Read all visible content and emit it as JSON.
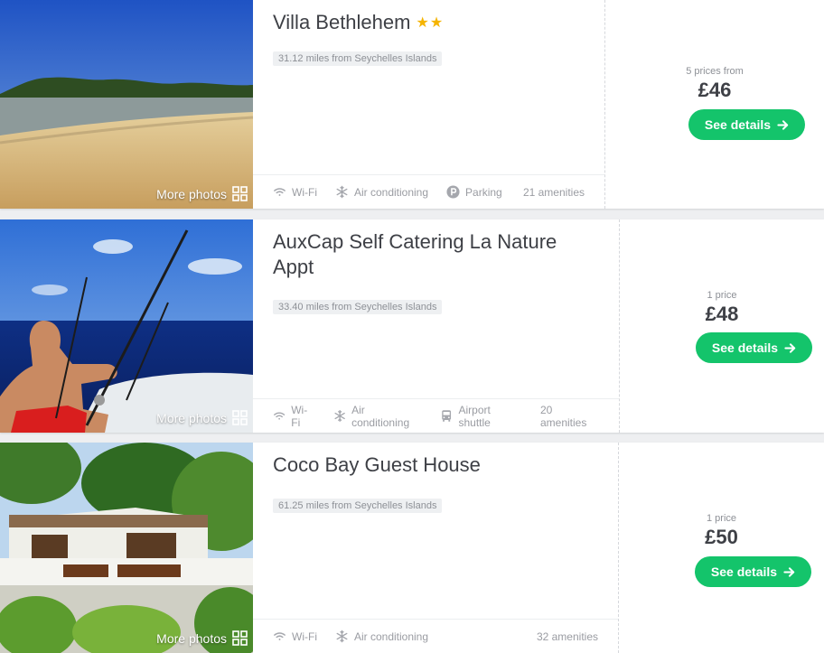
{
  "listings": [
    {
      "name": "Villa Bethlehem",
      "stars": "★★",
      "distance": "31.12 miles from Seychelles Islands",
      "more_photos": "More photos",
      "amenities": [
        {
          "icon": "wifi-icon",
          "label": "Wi-Fi"
        },
        {
          "icon": "snowflake-icon",
          "label": "Air conditioning"
        },
        {
          "icon": "parking-icon",
          "label": "Parking"
        }
      ],
      "amenity_count": "21 amenities",
      "prices_from": "5 prices from",
      "price": "£46",
      "cta": "See details"
    },
    {
      "name": "AuxCap Self Catering La Nature Appt",
      "distance": "33.40 miles from Seychelles Islands",
      "more_photos": "More photos",
      "amenities": [
        {
          "icon": "wifi-icon",
          "label": "Wi-Fi"
        },
        {
          "icon": "snowflake-icon",
          "label": "Air conditioning"
        },
        {
          "icon": "bus-icon",
          "label": "Airport shuttle"
        }
      ],
      "amenity_count": "20 amenities",
      "prices_from": "1 price",
      "price": "£48",
      "cta": "See details"
    },
    {
      "name": "Coco Bay Guest House",
      "distance": "61.25 miles from Seychelles Islands",
      "more_photos": "More photos",
      "amenities": [
        {
          "icon": "wifi-icon",
          "label": "Wi-Fi"
        },
        {
          "icon": "snowflake-icon",
          "label": "Air conditioning"
        }
      ],
      "amenity_count": "32 amenities",
      "prices_from": "1 price",
      "price": "£50",
      "cta": "See details"
    }
  ],
  "colors": {
    "accent": "#14c46b",
    "star": "#f5b400",
    "text": "#3e4046",
    "muted": "#8d9096"
  }
}
